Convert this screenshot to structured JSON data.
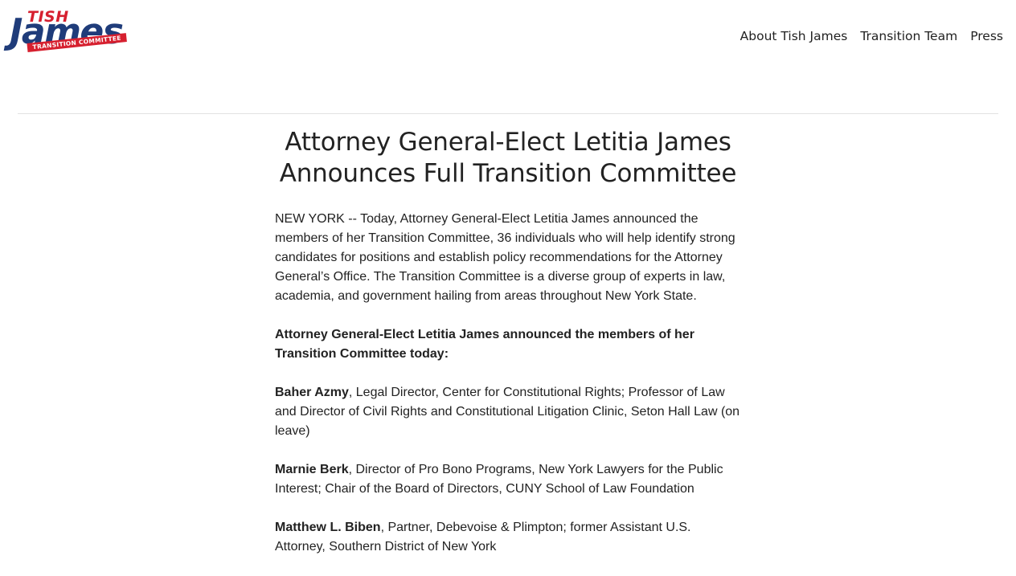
{
  "logo": {
    "top_word": "TISH",
    "main_word": "James",
    "banner": "TRANSITION COMMITTEE"
  },
  "nav": {
    "items": [
      {
        "label": "About Tish James"
      },
      {
        "label": "Transition Team"
      },
      {
        "label": "Press"
      }
    ]
  },
  "article": {
    "title": "Attorney General-Elect Letitia James Announces Full Transition Committee",
    "intro": "NEW YORK -- Today, Attorney General-Elect Letitia James announced the members of her Transition Committee, 36 individuals who will help identify strong candidates for positions and establish policy recommendations for the Attorney General’s Office. The Transition Committee is a diverse group of experts in law, academia, and government hailing from areas throughout New York State.",
    "lead": "Attorney General-Elect Letitia James announced the members of her Transition Committee today:",
    "members": [
      {
        "name": "Baher Azmy",
        "description": ", Legal Director, Center for Constitutional Rights; Professor of Law and Director of Civil Rights and Constitutional Litigation Clinic, Seton Hall Law (on leave)"
      },
      {
        "name": "Marnie Berk",
        "description": ", Director of Pro Bono Programs, New York Lawyers for the Public Interest; Chair of the Board of Directors, CUNY School of Law Foundation"
      },
      {
        "name": "Matthew L. Biben",
        "description": ", Partner, Debevoise & Plimpton; former Assistant U.S. Attorney, Southern District of New York"
      }
    ]
  },
  "colors": {
    "logo_red": "#d6202f",
    "logo_blue": "#1f3c7a",
    "text": "#222222",
    "divider": "#e2e2e2"
  }
}
